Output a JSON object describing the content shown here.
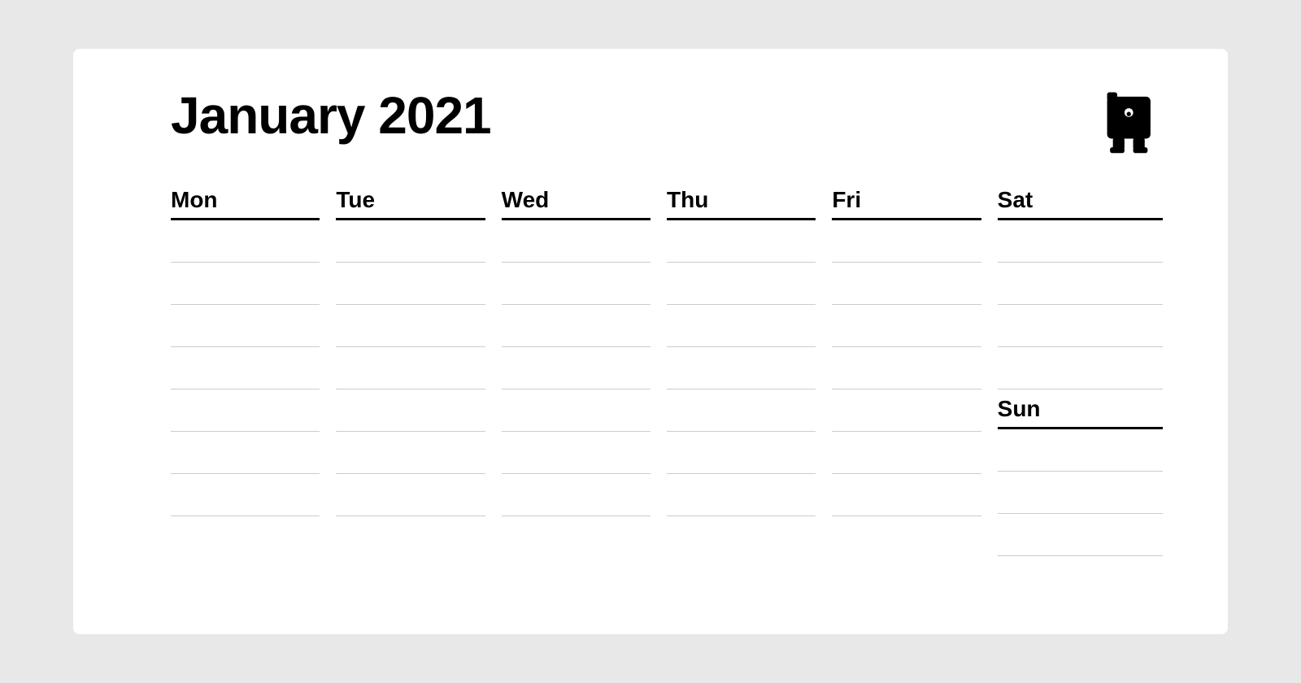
{
  "calendar": {
    "title": "January 2021",
    "days": [
      "Mon",
      "Tue",
      "Wed",
      "Thu",
      "Fri",
      "Sat"
    ],
    "sun_label": "Sun",
    "rows_count": 7,
    "colors": {
      "background": "#e8e8e8",
      "card": "#ffffff",
      "text": "#000000",
      "header_border": "#000000",
      "row_border": "#cccccc"
    }
  }
}
